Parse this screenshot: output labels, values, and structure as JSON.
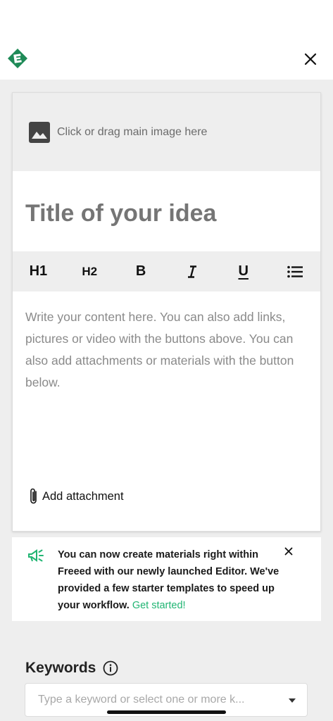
{
  "header": {
    "logo_icon": "freeed-logo",
    "close_icon": "close-icon",
    "brand_color": "#1e8a57"
  },
  "editor": {
    "image_drop_label": "Click or drag main image here",
    "title_placeholder": "Title of your idea",
    "toolbar": {
      "h1": "H1",
      "h2": "H2",
      "bold": "B",
      "italic": "I",
      "underline": "U",
      "list_icon": "bullet-list-icon"
    },
    "content_placeholder": "Write your content here. You can also add links, pictures or video with the buttons above. You can also add attachments or materials with the button below.",
    "attachment_label": "Add attachment"
  },
  "notice": {
    "message": "You can now create materials right within Freeed with our newly launched Editor. We've provided a few starter templates to speed up your workflow.",
    "link_label": "Get started!",
    "link_color": "#21b573"
  },
  "keywords": {
    "label": "Keywords",
    "placeholder": "Type a keyword or select one or more k..."
  }
}
